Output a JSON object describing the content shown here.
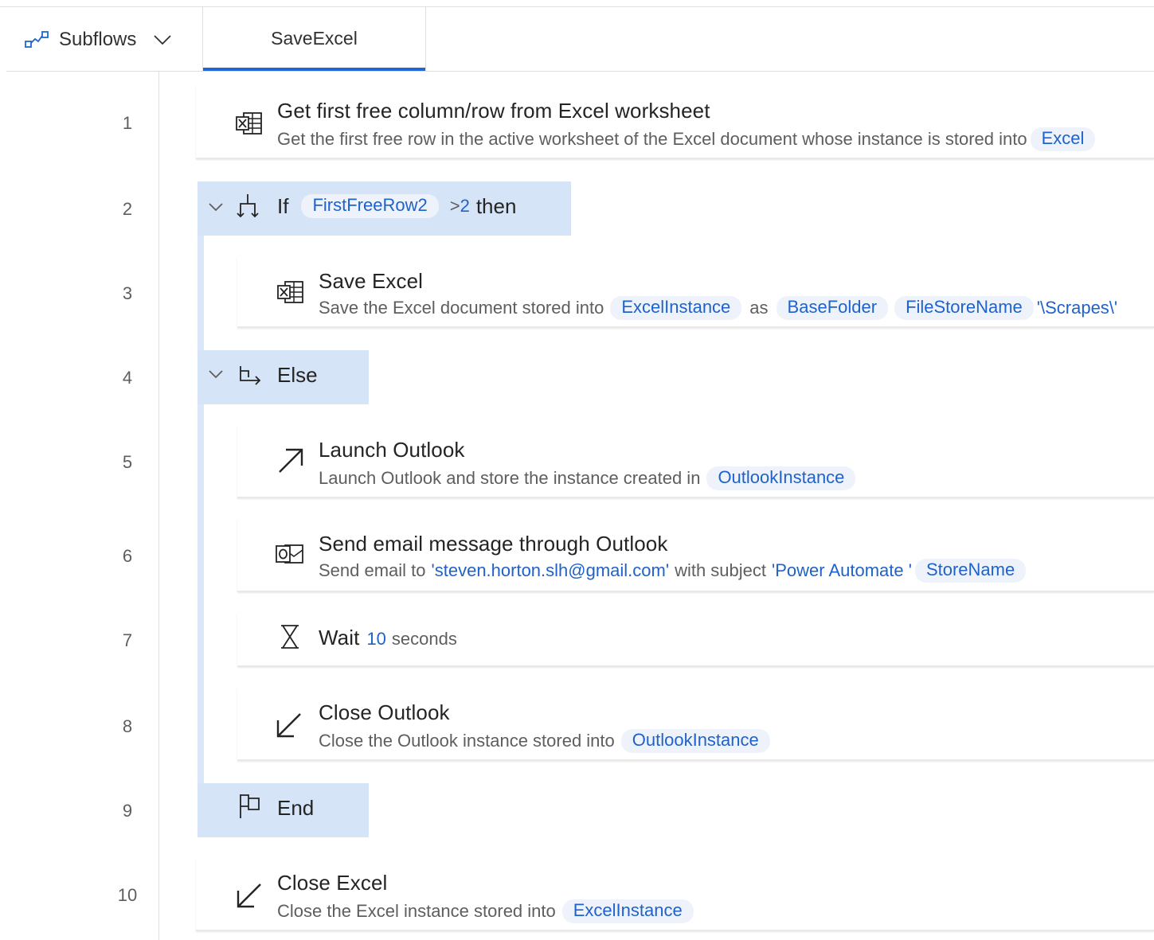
{
  "header": {
    "subflows_label": "Subflows",
    "active_tab": "SaveExcel"
  },
  "line_numbers": [
    "1",
    "2",
    "3",
    "4",
    "5",
    "6",
    "7",
    "8",
    "9",
    "10"
  ],
  "actions": {
    "a1": {
      "title": "Get first free column/row from Excel worksheet",
      "desc_text": "Get the first free row in the active worksheet of the Excel document whose instance is stored into",
      "var": "Excel"
    },
    "if": {
      "keyword": "If",
      "var": "FirstFreeRow2",
      "operator": ">",
      "value": "2",
      "then": "then"
    },
    "a3": {
      "title": "Save Excel",
      "desc_text": "Save the Excel document stored into",
      "var1": "ExcelInstance",
      "as": "as",
      "var2": "BaseFolder",
      "var3": "FileStoreName",
      "tail": "'\\Scrapes\\'"
    },
    "else": {
      "keyword": "Else"
    },
    "a5": {
      "title": "Launch Outlook",
      "desc_text": "Launch Outlook and store the instance created in",
      "var": "OutlookInstance"
    },
    "a6": {
      "title": "Send email message through Outlook",
      "desc_text": "Send email to",
      "email": "'steven.horton.slh@gmail.com'",
      "with_subject": "with subject",
      "subject": "'Power Automate '",
      "var": "StoreName"
    },
    "a7": {
      "title": "Wait",
      "value": "10",
      "unit": "seconds"
    },
    "a8": {
      "title": "Close Outlook",
      "desc_text": "Close the Outlook instance stored into",
      "var": "OutlookInstance"
    },
    "end": {
      "keyword": "End"
    },
    "a10": {
      "title": "Close Excel",
      "desc_text": "Close the Excel instance stored into",
      "var": "ExcelInstance"
    }
  },
  "colors": {
    "accent": "#2266d4",
    "variable_text": "#1f62c9",
    "variable_chip": "#eef3fb",
    "control_block": "#d6e4f7"
  },
  "icons": {
    "subflows": "subflows-icon",
    "subflows_chevron": "chevron-down-icon",
    "excel": "excel-icon",
    "condition": "condition-icon",
    "else": "else-icon",
    "launch": "arrow-up-right-icon",
    "outlook": "outlook-icon",
    "wait": "hourglass-icon",
    "close": "arrow-down-left-icon",
    "end": "flag-icon",
    "collapse": "chevron-down-icon"
  }
}
